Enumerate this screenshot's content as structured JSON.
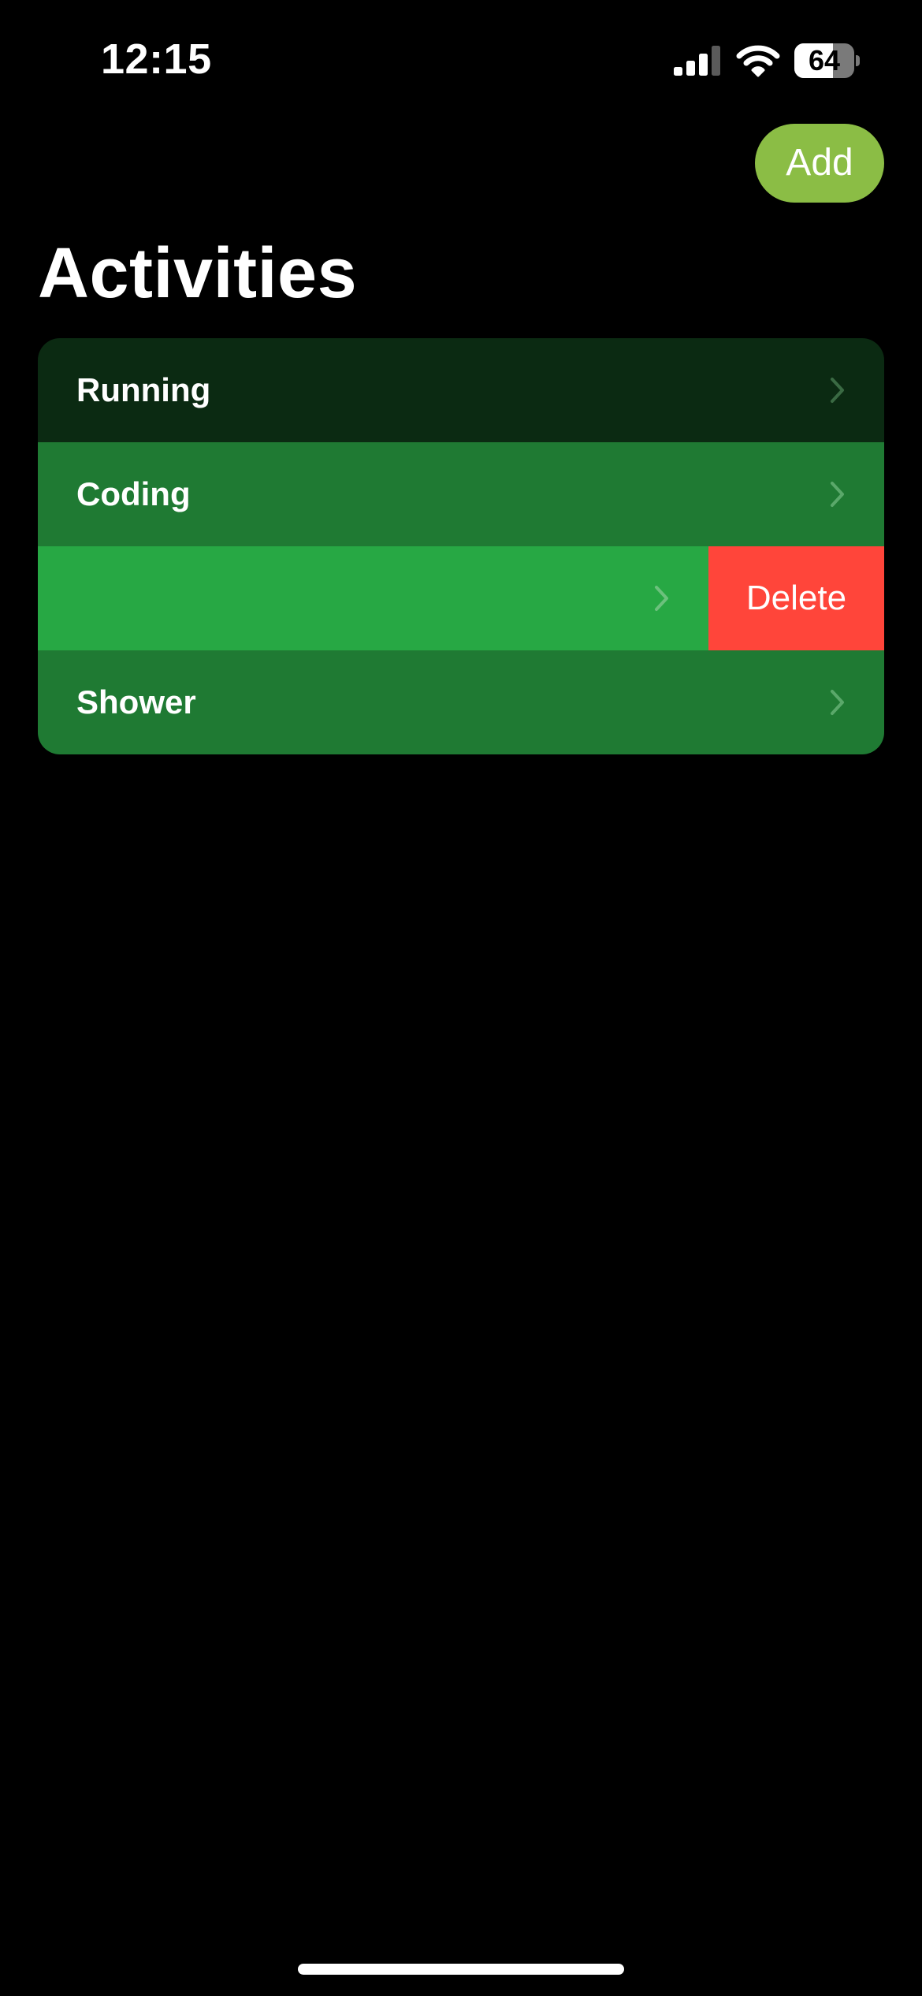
{
  "status_bar": {
    "time": "12:15",
    "battery_percent": "64",
    "battery_level": 0.64,
    "signal_bars_active": 3,
    "signal_bars_total": 4
  },
  "header": {
    "add_label": "Add",
    "title": "Activities"
  },
  "activities": [
    {
      "label": "Running",
      "color": "#0b2a12"
    },
    {
      "label": "Coding",
      "color": "#1f7a33"
    },
    {
      "label": "",
      "color": "#27a844",
      "swiped": true
    },
    {
      "label": "Shower",
      "color": "#1f7a33"
    }
  ],
  "swipe_action": {
    "label": "Delete",
    "color": "#ff453a"
  },
  "colors": {
    "accent": "#8bbd45",
    "background": "#000000"
  }
}
